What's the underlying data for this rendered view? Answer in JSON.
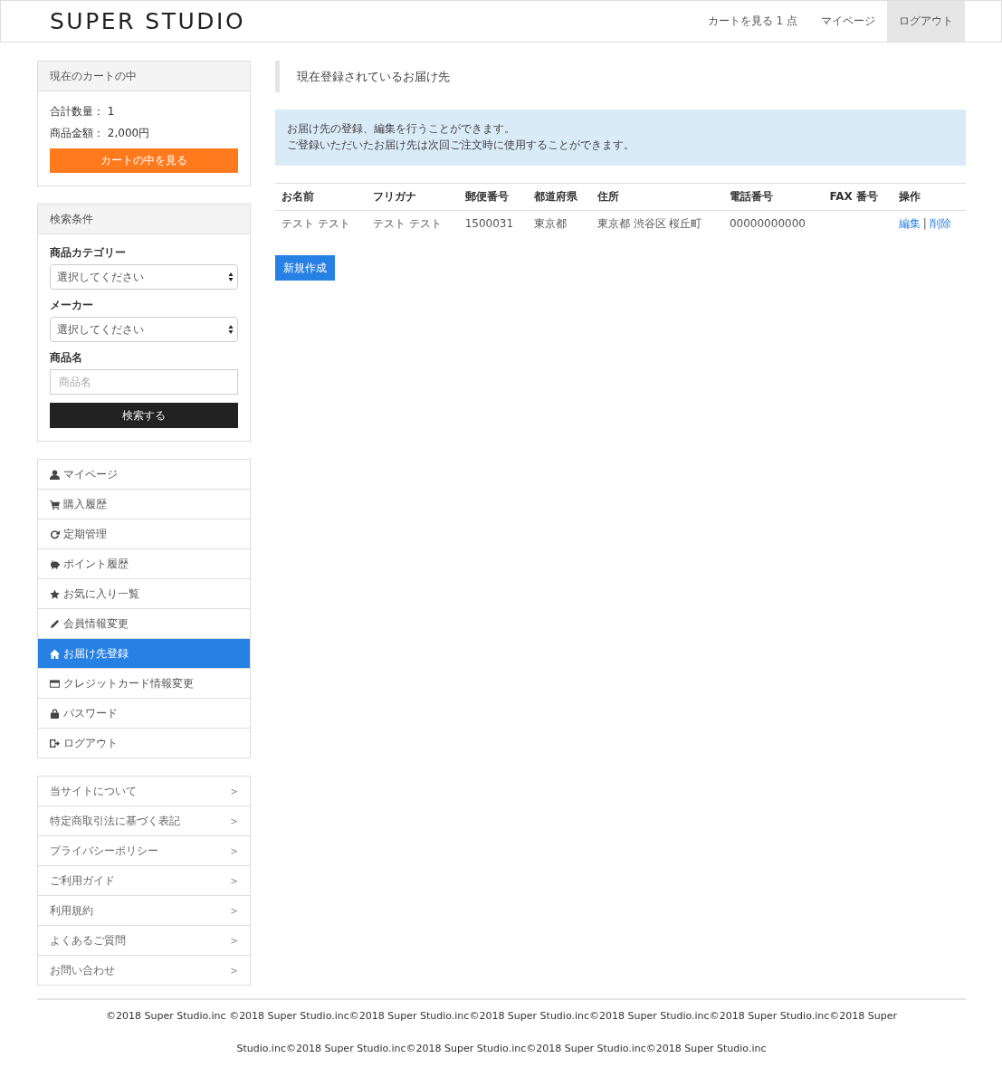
{
  "header": {
    "logo": "SUPER STUDIO",
    "nav": [
      {
        "label": "カートを見る 1 点",
        "selected": false
      },
      {
        "label": "マイページ",
        "selected": false
      },
      {
        "label": "ログアウト",
        "selected": true
      }
    ]
  },
  "cart": {
    "title": "現在のカートの中",
    "lines": [
      "合計数量： 1",
      "商品金額： 2,000円"
    ],
    "button": "カートの中を見る"
  },
  "search": {
    "title": "検索条件",
    "fields": [
      {
        "kind": "select",
        "label": "商品カテゴリー",
        "value": "選択してください"
      },
      {
        "kind": "select",
        "label": "メーカー",
        "value": "選択してください"
      },
      {
        "kind": "text",
        "label": "商品名",
        "placeholder": "商品名"
      }
    ],
    "button": "検索する"
  },
  "mypage_menu": [
    {
      "kind": "person",
      "label": "マイページ",
      "selected": false
    },
    {
      "kind": "cart",
      "label": "購入履歴",
      "selected": false
    },
    {
      "kind": "refresh",
      "label": "定期管理",
      "selected": false
    },
    {
      "kind": "piggy",
      "label": "ポイント履歴",
      "selected": false
    },
    {
      "kind": "star",
      "label": "お気に入り一覧",
      "selected": false
    },
    {
      "kind": "pencil",
      "label": "会員情報変更",
      "selected": false
    },
    {
      "kind": "home",
      "label": "お届け先登録",
      "selected": true
    },
    {
      "kind": "card",
      "label": "クレジットカード情報変更",
      "selected": false
    },
    {
      "kind": "lock",
      "label": "パスワード",
      "selected": false
    },
    {
      "kind": "logout",
      "label": "ログアウト",
      "selected": false
    }
  ],
  "info_menu": [
    {
      "label": "当サイトについて",
      "arrow": ">"
    },
    {
      "label": "特定商取引法に基づく表記",
      "arrow": ">"
    },
    {
      "label": "プライバシーポリシー",
      "arrow": ">"
    },
    {
      "label": "ご利用ガイド",
      "arrow": ">"
    },
    {
      "label": "利用規約",
      "arrow": ">"
    },
    {
      "label": "よくあるご質問",
      "arrow": ">"
    },
    {
      "label": "お問い合わせ",
      "arrow": ">"
    }
  ],
  "main": {
    "heading": "現在登録されているお届け先",
    "notice": [
      "お届け先の登録、編集を行うことができます。",
      "ご登録いただいたお届け先は次回ご注文時に使用することができます。"
    ],
    "table": {
      "columns": [
        "お名前",
        "フリガナ",
        "郵便番号",
        "都道府県",
        "住所",
        "電話番号",
        "FAX 番号",
        "操作"
      ],
      "rows": [
        {
          "cells": [
            "テスト テスト",
            "テスト テスト",
            "1500031",
            "東京都",
            "東京都 渋谷区 桜丘町",
            "00000000000",
            ""
          ],
          "actions": [
            "編集",
            "削除"
          ],
          "separator": "|"
        }
      ]
    },
    "new_button": "新規作成"
  },
  "footer": "©2018 Super Studio.inc ©2018 Super Studio.inc©2018 Super Studio.inc©2018 Super Studio.inc©2018 Super Studio.inc©2018 Super Studio.inc©2018 Super Studio.inc©2018 Super Studio.inc©2018 Super Studio.inc©2018 Super Studio.inc©2018 Super Studio.inc"
}
